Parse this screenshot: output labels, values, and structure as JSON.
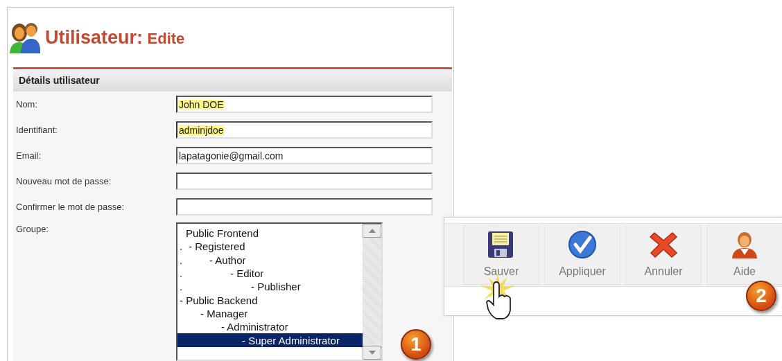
{
  "header": {
    "title": "Utilisateur:",
    "subtitle": "Edite"
  },
  "section": {
    "title": "Détails utilisateur"
  },
  "fields": [
    {
      "label": "Nom:",
      "value": "John DOE",
      "autofilled": true
    },
    {
      "label": "Identifiant:",
      "value": "adminjdoe",
      "autofilled": true
    },
    {
      "label": "Email:",
      "value": "lapatagonie@gmail.com",
      "autofilled": false
    },
    {
      "label": "Nouveau mot de passe:",
      "autofilled": false
    },
    {
      "label": "Confirmer le mot de passe:",
      "autofilled": false
    }
  ],
  "group": {
    "label": "Groupe:",
    "items": [
      {
        "label": "Public Frontend",
        "selected": false,
        "children": [
          {
            "dot": ".",
            "label": "- Registered",
            "selected": false,
            "children": [
              {
                "dot": ".",
                "label": "- Author",
                "selected": false,
                "children": [
                  {
                    "dot": ".",
                    "label": "- Editor",
                    "selected": false,
                    "children": [
                      {
                        "dot": ".",
                        "label": "- Publisher",
                        "selected": false
                      }
                    ]
                  }
                ]
              }
            ]
          }
        ]
      },
      {
        "label": "- Public Backend",
        "selected": false,
        "children": [
          {
            "label": "- Manager",
            "selected": false,
            "children": [
              {
                "label": "- Administrator",
                "selected": false,
                "children": [
                  {
                    "label": "- Super Administrator",
                    "selected": true
                  }
                ]
              }
            ]
          }
        ]
      }
    ]
  },
  "toolbar": {
    "buttons": [
      {
        "kind": "save",
        "label": "Sauver"
      },
      {
        "kind": "apply",
        "label": "Appliquer"
      },
      {
        "kind": "cancel",
        "label": "Annuler"
      },
      {
        "kind": "help",
        "label": "Aide"
      }
    ]
  },
  "steps": [
    "1",
    "2"
  ]
}
